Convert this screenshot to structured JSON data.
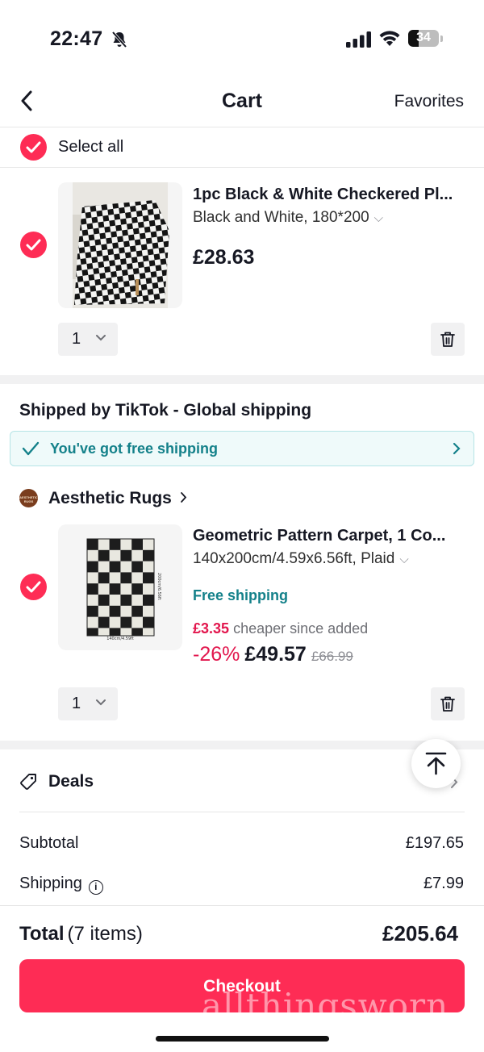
{
  "status_bar": {
    "time": "22:47",
    "battery": "34",
    "battery_level": 0.34
  },
  "nav": {
    "title": "Cart",
    "favorites": "Favorites"
  },
  "select_all": {
    "label": "Select all",
    "checked": true
  },
  "items": [
    {
      "title": "1pc Black & White Checkered Pl...",
      "variant": "Black and White, 180*200",
      "price": "£28.63",
      "quantity": "1",
      "checked": true
    },
    {
      "title": "Geometric Pattern Carpet, 1 Co...",
      "variant": "140x200cm/4.59x6.56ft, Plaid",
      "free_shipping": "Free shipping",
      "cheaper_amount": "£3.35",
      "cheaper_text": "cheaper since added",
      "discount": "-26%",
      "price": "£49.57",
      "original_price": "£66.99",
      "quantity": "1",
      "checked": true,
      "image_label_bottom": "140cm/4.59ft",
      "image_label_side": "200cm/6.56ft"
    }
  ],
  "shipping_section": {
    "title": "Shipped by TikTok - Global shipping",
    "free_banner": "You've got free shipping"
  },
  "shop": {
    "name": "Aesthetic Rugs",
    "logo_text": "AESTHETIC RUGS"
  },
  "deals": {
    "label": "Deals"
  },
  "summary": {
    "subtotal_label": "Subtotal",
    "subtotal": "£197.65",
    "shipping_label": "Shipping",
    "shipping": "£7.99",
    "total_label": "Total",
    "total_items": "(7 items)",
    "total": "£205.64"
  },
  "checkout": {
    "label": "Checkout"
  },
  "watermark": "allthingsworn",
  "colors": {
    "accent": "#fe2c55",
    "teal": "#14818a",
    "discount": "#e2164d"
  }
}
